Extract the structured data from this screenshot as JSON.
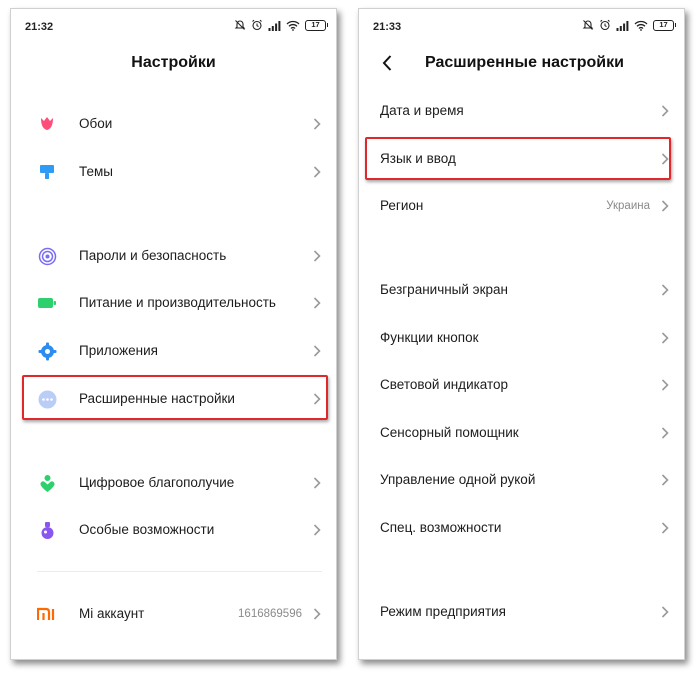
{
  "left": {
    "status": {
      "time": "21:32",
      "battery": "17"
    },
    "title": "Настройки",
    "items": [
      {
        "label": "Обои",
        "icon": "tulip-icon"
      },
      {
        "label": "Темы",
        "icon": "paint-roller-icon"
      },
      {
        "label": "Пароли и безопасность",
        "icon": "fingerprint-icon"
      },
      {
        "label": "Питание и производительность",
        "icon": "battery-icon"
      },
      {
        "label": "Приложения",
        "icon": "gear-icon"
      },
      {
        "label": "Расширенные настройки",
        "icon": "more-dots-icon"
      },
      {
        "label": "Цифровое благополучие",
        "icon": "heart-person-icon"
      },
      {
        "label": "Особые возможности",
        "icon": "flask-icon"
      },
      {
        "label": "Mi аккаунт",
        "icon": "mi-logo-icon",
        "value": "1616869596"
      }
    ]
  },
  "right": {
    "status": {
      "time": "21:33",
      "battery": "17"
    },
    "title": "Расширенные настройки",
    "items": [
      {
        "label": "Дата и время"
      },
      {
        "label": "Язык и ввод"
      },
      {
        "label": "Регион",
        "value": "Украина"
      },
      {
        "label": "Безграничный экран"
      },
      {
        "label": "Функции кнопок"
      },
      {
        "label": "Световой индикатор"
      },
      {
        "label": "Сенсорный помощник"
      },
      {
        "label": "Управление одной рукой"
      },
      {
        "label": "Спец. возможности"
      },
      {
        "label": "Режим предприятия"
      }
    ]
  },
  "colors": {
    "highlight": "#e0282c",
    "tulip": "#ff4d7a",
    "theme": "#2f9bf5",
    "security": "#7b6cf6",
    "power": "#2ed06e",
    "apps": "#2d8cf0",
    "more": "#8fb3f5",
    "wellbeing": "#2ed06e",
    "accessibility": "#8a56f0",
    "mi": "#ff6a00"
  }
}
